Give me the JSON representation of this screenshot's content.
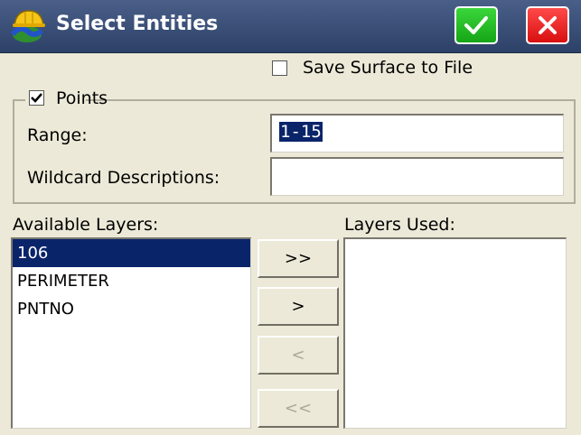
{
  "window": {
    "title": "Select Entities",
    "ok_icon": "checkmark-icon",
    "close_icon": "close-x-icon"
  },
  "save_surface": {
    "label": "Save Surface to File",
    "checked": false
  },
  "points": {
    "label": "Points",
    "checked": true,
    "range_label": "Range:",
    "range_value": "1-15",
    "wildcard_label": "Wildcard Descriptions:",
    "wildcard_value": ""
  },
  "available_layers": {
    "label": "Available Layers:",
    "items": [
      "106",
      "PERIMETER",
      "PNTNO"
    ],
    "selected": "106"
  },
  "layers_used": {
    "label": "Layers Used:",
    "items": []
  },
  "transfer_buttons": {
    "add_all": ">>",
    "add": ">",
    "remove": "<",
    "remove_all": "<<"
  },
  "colors": {
    "titlebar": "#2d4168",
    "ok_button": "#16a516",
    "close_button": "#d90f0f",
    "selection": "#0a246a",
    "dialog_background": "#ece9d8"
  }
}
